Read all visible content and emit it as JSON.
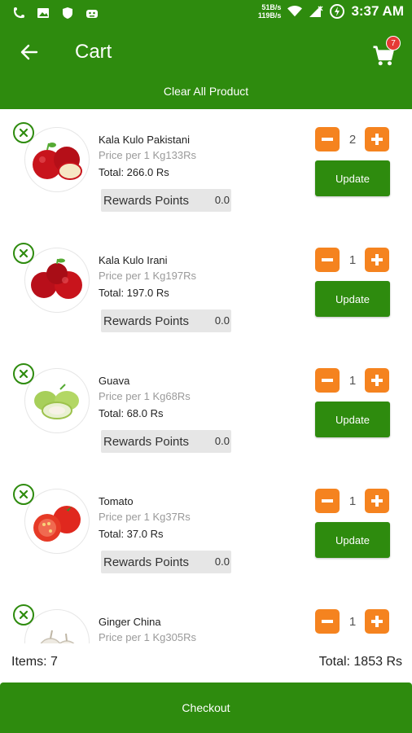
{
  "status_bar": {
    "net_up": "51B/s",
    "net_down": "119B/s",
    "time": "3:37 AM"
  },
  "toolbar": {
    "title": "Cart",
    "cart_badge": "7",
    "clear_all_label": "Clear All Product",
    "color": "#2e8b0e"
  },
  "items": [
    {
      "name": "Kala Kulo Pakistani",
      "price": "Price per 1 Kg133Rs",
      "total": "Total: 266.0 Rs",
      "rewards_label": "Rewards Points",
      "rewards_value": "0.0",
      "qty": "2",
      "update_label": "Update",
      "image": "apple"
    },
    {
      "name": "Kala Kulo Irani",
      "price": "Price per 1 Kg197Rs",
      "total": "Total: 197.0 Rs",
      "rewards_label": "Rewards Points",
      "rewards_value": "0.0",
      "qty": "1",
      "update_label": "Update",
      "image": "apple"
    },
    {
      "name": "Guava",
      "price": "Price per 1 Kg68Rs",
      "total": "Total: 68.0 Rs",
      "rewards_label": "Rewards Points",
      "rewards_value": "0.0",
      "qty": "1",
      "update_label": "Update",
      "image": "guava"
    },
    {
      "name": "Tomato",
      "price": "Price per 1 Kg37Rs",
      "total": "Total: 37.0 Rs",
      "rewards_label": "Rewards Points",
      "rewards_value": "0.0",
      "qty": "1",
      "update_label": "Update",
      "image": "tomato"
    },
    {
      "name": "Ginger China",
      "price": "Price per 1 Kg305Rs",
      "qty": "1",
      "image": "garlic"
    }
  ],
  "summary": {
    "items_count": "Items: 7",
    "total": "Total: 1853 Rs"
  },
  "checkout_label": "Checkout",
  "accent": "#f5831f"
}
